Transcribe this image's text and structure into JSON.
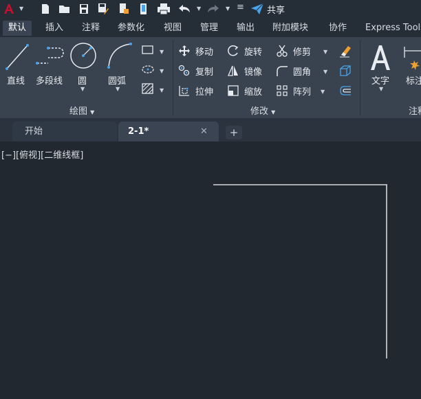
{
  "qat": {
    "share_label": "共享"
  },
  "tabs": [
    {
      "label": "默认",
      "active": true
    },
    {
      "label": "插入"
    },
    {
      "label": "注释"
    },
    {
      "label": "参数化"
    },
    {
      "label": "视图"
    },
    {
      "label": "管理"
    },
    {
      "label": "输出"
    },
    {
      "label": "附加模块"
    },
    {
      "label": "协作"
    },
    {
      "label": "Express Tools"
    }
  ],
  "draw_panel": {
    "title": "绘图",
    "line": "直线",
    "polyline": "多段线",
    "circle": "圆",
    "arc": "圆弧"
  },
  "modify_panel": {
    "title": "修改",
    "move": "移动",
    "rotate": "旋转",
    "trim": "修剪",
    "copy": "复制",
    "mirror": "镜像",
    "fillet": "圆角",
    "stretch": "拉伸",
    "scale": "缩放",
    "array": "阵列"
  },
  "annotation_panel": {
    "title": "注释",
    "text": "文字",
    "dimension": "标注"
  },
  "doc_tabs": {
    "start": "开始",
    "current": "2-1*",
    "close": "✕",
    "add": "+"
  },
  "viewport_label": "[−][俯视][二维线框]",
  "colors": {
    "accent": "#4aa3e8",
    "brand": "#c8102e",
    "background": "#212830",
    "ribbon": "#39424f"
  }
}
